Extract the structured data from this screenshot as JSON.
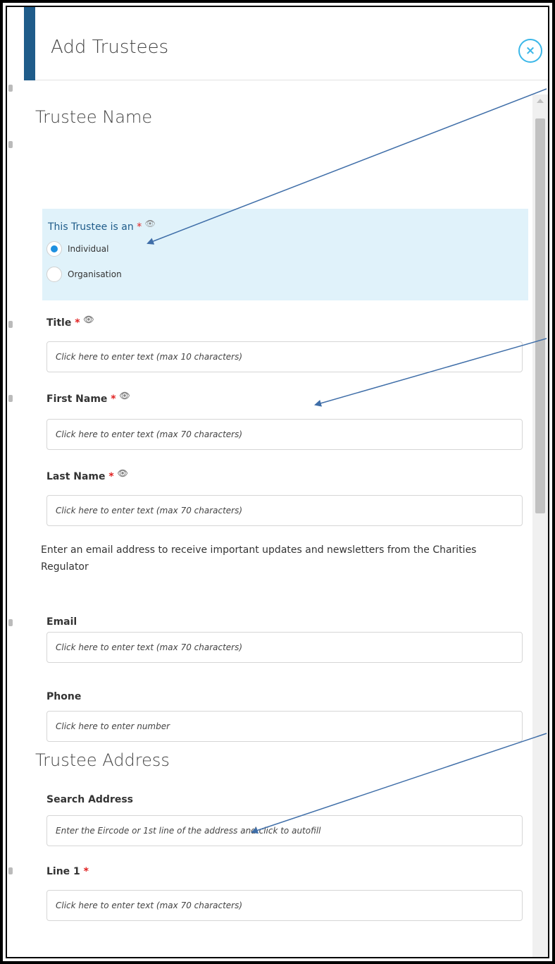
{
  "header": {
    "title": "Add Trustees",
    "close_label": "×"
  },
  "trustee_name_section": {
    "title": "Trustee Name",
    "trustee_type": {
      "label": "This Trustee is an",
      "required_mark": "*",
      "options": [
        {
          "label": "Individual",
          "selected": true
        },
        {
          "label": "Organisation",
          "selected": false
        }
      ]
    },
    "fields": {
      "title": {
        "label": "Title",
        "required_mark": "*",
        "value": "",
        "placeholder": "Click here to enter text (max 10 characters)"
      },
      "first_name": {
        "label": "First Name",
        "required_mark": "*",
        "value": "",
        "placeholder": "Click here to enter text (max 70 characters)"
      },
      "last_name": {
        "label": "Last Name",
        "required_mark": "*",
        "value": "",
        "placeholder": "Click here to enter text (max 70 characters)"
      }
    },
    "email_notice": "Enter an email address to receive important updates and newsletters from the Charities Regulator",
    "email": {
      "label": "Email",
      "value": "",
      "placeholder": "Click here to enter text (max 70 characters)"
    },
    "phone": {
      "label": "Phone",
      "value": "",
      "placeholder": "Click here to enter number"
    }
  },
  "trustee_address_section": {
    "title": "Trustee Address",
    "search_address": {
      "label": "Search Address",
      "value": "",
      "placeholder": "Enter the Eircode or 1st line of the address and click to autofill"
    },
    "line1": {
      "label": "Line 1",
      "required_mark": "*",
      "value": "",
      "placeholder": "Click here to enter text (max 70 characters)"
    }
  },
  "colors": {
    "accent": "#1f5c8a",
    "close_ring": "#3bb7e8",
    "radio_panel": "#e0f2fa",
    "radio_selected": "#1e90e0",
    "required": "#e02020",
    "annotation_arrow": "#3f6ea8"
  },
  "icons": {
    "close": "close-icon",
    "visibility": "eye-icon"
  }
}
